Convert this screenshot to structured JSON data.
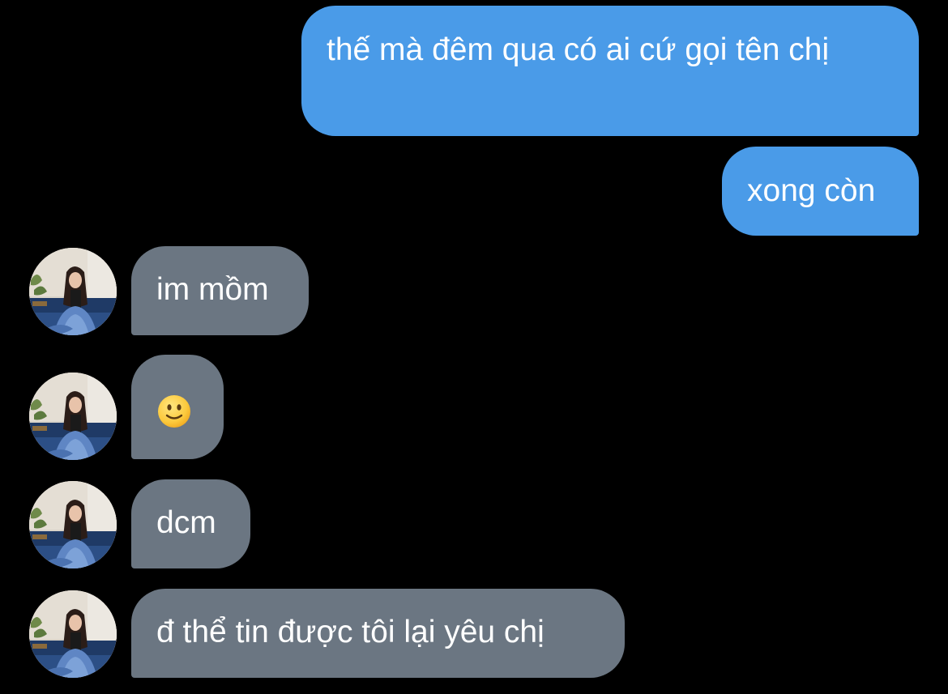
{
  "colors": {
    "background": "#000000",
    "sent_bubble": "#4a9be8",
    "received_bubble": "#6b7682",
    "text": "#ffffff"
  },
  "messages": [
    {
      "sender": "me",
      "text": "thế mà đêm qua có ai cứ gọi tên chị"
    },
    {
      "sender": "me",
      "text": "xong còn"
    },
    {
      "sender": "contact",
      "text": "im mồm"
    },
    {
      "sender": "contact",
      "text": "🙂",
      "icon": "slightly-smiling-face-emoji"
    },
    {
      "sender": "contact",
      "text": "dcm"
    },
    {
      "sender": "contact",
      "text": "đ thể tin được tôi lại yêu chị"
    }
  ],
  "contact": {
    "avatar_icon": "profile-photo"
  }
}
